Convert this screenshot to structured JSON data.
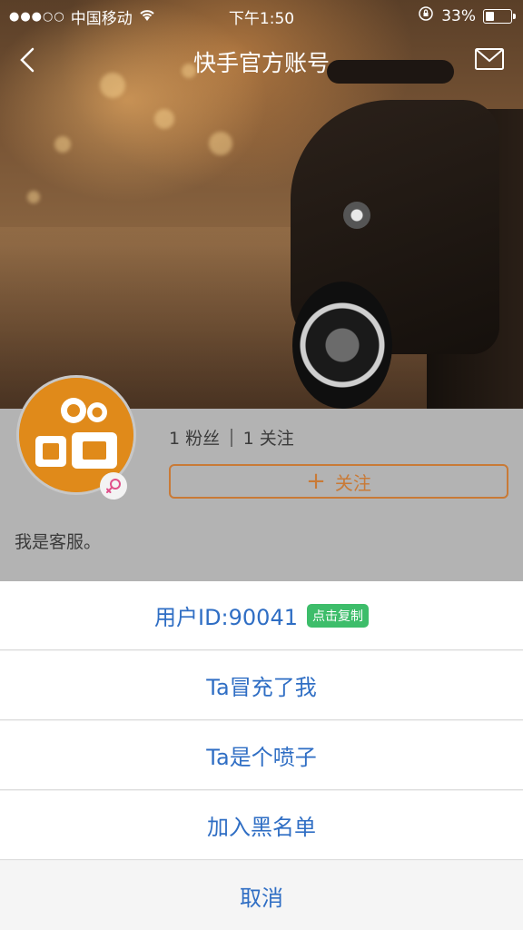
{
  "status_bar": {
    "signal": "●●●○○",
    "carrier": "中国移动",
    "time": "下午1:50",
    "battery": "33%",
    "battery_level": 0.33
  },
  "nav": {
    "title": "快手官方账号",
    "back_icon": "chevron-left-icon",
    "mail_icon": "envelope-icon"
  },
  "profile": {
    "fans": "1 粉丝",
    "following": "1 关注",
    "follow_label": "关注",
    "bio": "我是客服。"
  },
  "sheet": {
    "user_id": "用户ID:90041",
    "copy_label": "点击复制",
    "items": [
      "Ta冒充了我",
      "Ta是个喷子",
      "加入黑名单"
    ],
    "cancel": "取消"
  },
  "colors": {
    "accent": "#2f6ec4",
    "follow": "#c97a36",
    "copy_badge": "#3dbd6a",
    "avatar": "#e08a1a"
  }
}
